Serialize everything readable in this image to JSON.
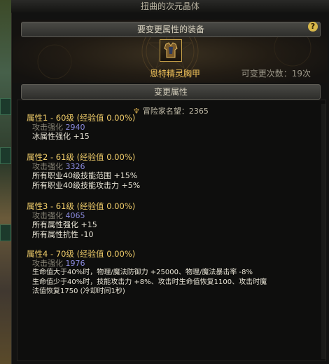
{
  "window": {
    "title": "扭曲的次元晶体"
  },
  "equip_section": {
    "header": "要变更属性的装备",
    "help_label": "?"
  },
  "item": {
    "name": "恩特精灵胸甲",
    "change_count": "可变更次数：19次"
  },
  "attr_section": {
    "header": "变更属性"
  },
  "fame": {
    "icon": "adventurer-fame-icon",
    "text": "冒险家名望：2365"
  },
  "attributes": [
    {
      "title": "属性1 - 60级 (经验值 0.00%)",
      "sub_label": "攻击强化 ",
      "sub_value": "2940",
      "lines": [
        "冰属性强化 +15"
      ]
    },
    {
      "title": "属性2 - 61级 (经验值 0.00%)",
      "sub_label": "攻击强化 ",
      "sub_value": "3326",
      "lines": [
        "所有职业40级技能范围 +15%",
        "所有职业40级技能攻击力 +5%"
      ]
    },
    {
      "title": "属性3 - 61级 (经验值 0.00%)",
      "sub_label": "攻击强化 ",
      "sub_value": "4065",
      "lines": [
        "所有属性强化 +15",
        "所有属性抗性 -10"
      ]
    },
    {
      "title": "属性4 - 70级 (经验值 0.00%)",
      "sub_label": "攻击强化 ",
      "sub_value": "1976",
      "lines": [
        "生命值大于40%时，物理/魔法防御力 +25000、物理/魔法暴击率 -8%",
        "生命值少于40%时，技能攻击力 +8%、攻击时生命值恢复1100、攻击时魔",
        "法值恢复1750 (冷却时间1秒)"
      ]
    }
  ],
  "colors": {
    "gold": "#f3cf6b",
    "blue_value": "#8c8ce0",
    "item_name": "#f0c25a"
  }
}
